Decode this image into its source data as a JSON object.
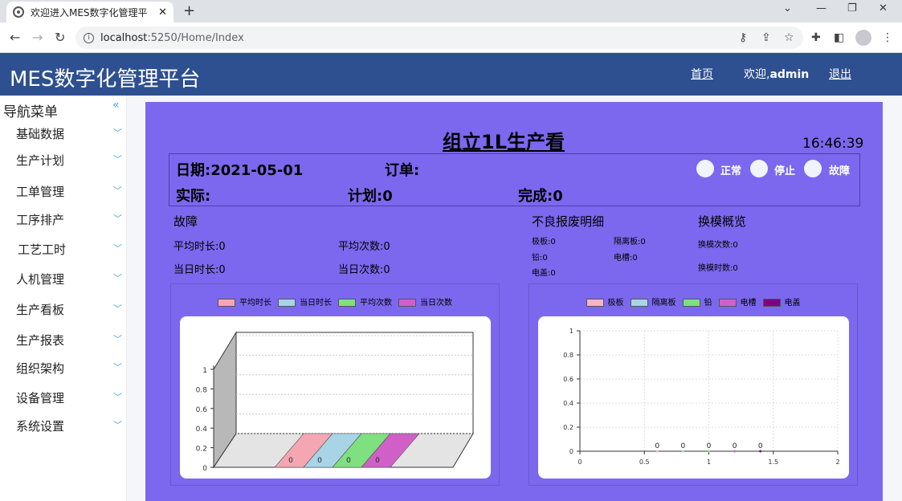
{
  "browser": {
    "tab_title": "欢迎进入MES数字化管理平",
    "url_host": "localhost",
    "url_rest": ":5250/Home/Index"
  },
  "header": {
    "title": "MES数字化管理平台",
    "home": "首页",
    "welcome": "欢迎,",
    "user": "admin",
    "logout": "退出"
  },
  "sidebar": {
    "heading": "导航菜单",
    "items": [
      {
        "label": "基础数据"
      },
      {
        "label": "生产计划"
      },
      {
        "label": "工单管理"
      },
      {
        "label": "工序排产"
      },
      {
        "label": "工艺工时"
      },
      {
        "label": "人机管理"
      },
      {
        "label": "生产看板"
      },
      {
        "label": "生产报表"
      },
      {
        "label": "组织架构"
      },
      {
        "label": "设备管理"
      },
      {
        "label": "系统设置"
      }
    ]
  },
  "board": {
    "title": "组立1L生产看",
    "clock": "16:46:39",
    "date": "日期:2021-05-01",
    "order": "订单:",
    "actual": "实际:",
    "plan": "计划:0",
    "done": "完成:0",
    "status": {
      "normal": "正常",
      "stop": "停止",
      "fault": "故障"
    },
    "fault": {
      "heading": "故障",
      "avg_duration": "平均时长:0",
      "avg_count": "平均次数:0",
      "today_duration": "当日时长:0",
      "today_count": "当日次数:0"
    },
    "defect": {
      "heading": "不良报废明细",
      "jiban": "极板:0",
      "gelieban": "隔离板:0",
      "qian": "铅:0",
      "diancao": "电槽:0",
      "diangai": "电盖:0"
    },
    "mold": {
      "heading": "换模概览",
      "count": "换模次数:0",
      "time": "换模时数:0"
    }
  },
  "chart_data": [
    {
      "type": "bar",
      "categories": [
        ""
      ],
      "series": [
        {
          "name": "平均时长",
          "values": [
            0
          ],
          "color": "#f4a6b2"
        },
        {
          "name": "当日时长",
          "values": [
            0
          ],
          "color": "#a8d4e6"
        },
        {
          "name": "平均次数",
          "values": [
            0
          ],
          "color": "#7ee07e"
        },
        {
          "name": "当日次数",
          "values": [
            0
          ],
          "color": "#d060c8"
        }
      ],
      "ylim": [
        0,
        1
      ],
      "yticks": [
        "0",
        "0.2",
        "0.4",
        "0.6",
        "0.8",
        "1"
      ],
      "grid": true,
      "legend": "top"
    },
    {
      "type": "scatter",
      "series": [
        {
          "name": "极板",
          "x": [
            0.6
          ],
          "y": [
            0
          ],
          "color": "#f4b6c2"
        },
        {
          "name": "隔离板",
          "x": [
            0.8
          ],
          "y": [
            0
          ],
          "color": "#a8d4e6"
        },
        {
          "name": "铅",
          "x": [
            1.0
          ],
          "y": [
            0
          ],
          "color": "#7ee07e"
        },
        {
          "name": "电槽",
          "x": [
            1.2
          ],
          "y": [
            0
          ],
          "color": "#d060c8"
        },
        {
          "name": "电盖",
          "x": [
            1.4
          ],
          "y": [
            0
          ],
          "color": "#800080"
        }
      ],
      "xlim": [
        0,
        2
      ],
      "ylim": [
        0,
        1
      ],
      "xticks": [
        "0",
        "0.5",
        "1",
        "1.5",
        "2"
      ],
      "yticks": [
        "0",
        "0.2",
        "0.4",
        "0.6",
        "0.8",
        "1"
      ],
      "grid": true,
      "legend": "top"
    }
  ]
}
